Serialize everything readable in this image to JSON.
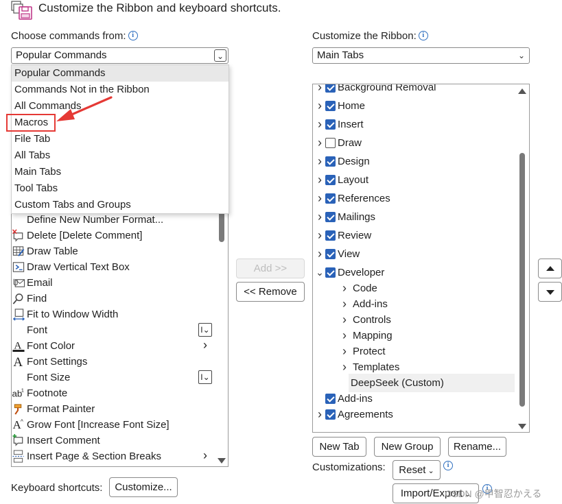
{
  "header": {
    "title": "Customize the Ribbon and keyboard shortcuts."
  },
  "left": {
    "label": "Choose commands from:",
    "combo_value": "Popular Commands",
    "dropdown_items": [
      "Popular Commands",
      "Commands Not in the Ribbon",
      "All Commands",
      "Macros",
      "File Tab",
      "All Tabs",
      "Main Tabs",
      "Tool Tabs",
      "Custom Tabs and Groups"
    ],
    "highlighted_item": "Macros",
    "commands": [
      {
        "label": "Define New Number Format...",
        "icon": "blank"
      },
      {
        "label": "Delete [Delete Comment]",
        "icon": "delete-comment-icon"
      },
      {
        "label": "Draw Table",
        "icon": "draw-table-icon"
      },
      {
        "label": "Draw Vertical Text Box",
        "icon": "vertical-textbox-icon"
      },
      {
        "label": "Email",
        "icon": "email-icon"
      },
      {
        "label": "Find",
        "icon": "find-icon"
      },
      {
        "label": "Fit to Window Width",
        "icon": "fit-width-icon"
      },
      {
        "label": "Font",
        "icon": "blank"
      },
      {
        "label": "Font Color",
        "icon": "font-color-icon"
      },
      {
        "label": "Font Settings",
        "icon": "font-settings-icon"
      },
      {
        "label": "Font Size",
        "icon": "blank"
      },
      {
        "label": "Footnote",
        "icon": "footnote-icon"
      },
      {
        "label": "Format Painter",
        "icon": "format-painter-icon"
      },
      {
        "label": "Grow Font [Increase Font Size]",
        "icon": "grow-font-icon"
      },
      {
        "label": "Insert Comment",
        "icon": "insert-comment-icon"
      },
      {
        "label": "Insert Page & Section Breaks",
        "icon": "page-break-icon"
      }
    ]
  },
  "middle": {
    "add_label": "Add >>",
    "remove_label": "<< Remove"
  },
  "right": {
    "label": "Customize the Ribbon:",
    "combo_value": "Main Tabs",
    "tree": [
      {
        "label": "Background Removal",
        "level": 0,
        "checked": true,
        "expand": "collapsed"
      },
      {
        "label": "Home",
        "level": 0,
        "checked": true,
        "expand": "collapsed"
      },
      {
        "label": "Insert",
        "level": 0,
        "checked": true,
        "expand": "collapsed"
      },
      {
        "label": "Draw",
        "level": 0,
        "checked": false,
        "expand": "collapsed"
      },
      {
        "label": "Design",
        "level": 0,
        "checked": true,
        "expand": "collapsed"
      },
      {
        "label": "Layout",
        "level": 0,
        "checked": true,
        "expand": "collapsed"
      },
      {
        "label": "References",
        "level": 0,
        "checked": true,
        "expand": "collapsed"
      },
      {
        "label": "Mailings",
        "level": 0,
        "checked": true,
        "expand": "collapsed"
      },
      {
        "label": "Review",
        "level": 0,
        "checked": true,
        "expand": "collapsed"
      },
      {
        "label": "View",
        "level": 0,
        "checked": true,
        "expand": "collapsed"
      },
      {
        "label": "Developer",
        "level": 0,
        "checked": true,
        "expand": "expanded"
      },
      {
        "label": "Code",
        "level": 1,
        "expand": "collapsed"
      },
      {
        "label": "Add-ins",
        "level": 1,
        "expand": "collapsed"
      },
      {
        "label": "Controls",
        "level": 1,
        "expand": "collapsed"
      },
      {
        "label": "Mapping",
        "level": 1,
        "expand": "collapsed"
      },
      {
        "label": "Protect",
        "level": 1,
        "expand": "collapsed"
      },
      {
        "label": "Templates",
        "level": 1,
        "expand": "collapsed"
      },
      {
        "label": "DeepSeek (Custom)",
        "level": 1,
        "expand": "none",
        "selected": true
      },
      {
        "label": "Add-ins",
        "level": 0,
        "checked": true,
        "expand": "none"
      },
      {
        "label": "Agreements",
        "level": 0,
        "checked": true,
        "expand": "collapsed"
      }
    ],
    "buttons": {
      "new_tab": "New Tab",
      "new_group": "New Group",
      "rename": "Rename..."
    },
    "customizations_label": "Customizations:",
    "reset_label": "Reset",
    "import_export_label": "Import/Export"
  },
  "footer": {
    "keyboard_label": "Keyboard shortcuts:",
    "customize_label": "Customize..."
  },
  "watermark": "CSDN @甲智忍かえる",
  "colors": {
    "accent": "#2a62b8",
    "highlight": "#e53935",
    "info": "#2f6fbf"
  }
}
